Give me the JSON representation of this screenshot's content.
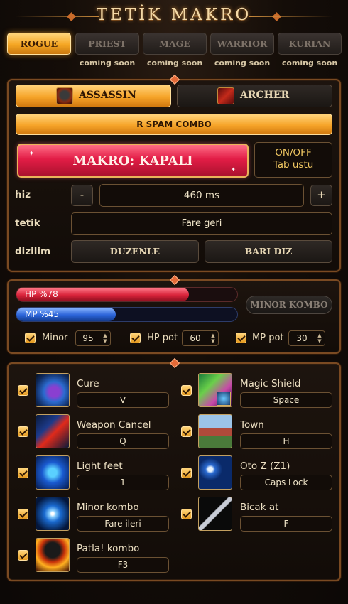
{
  "app": {
    "title": "TETİK MAKRO"
  },
  "tabs": [
    {
      "label": "ROGUE",
      "active": true,
      "note": ""
    },
    {
      "label": "PRIEST",
      "active": false,
      "note": "coming soon"
    },
    {
      "label": "MAGE",
      "active": false,
      "note": "coming soon"
    },
    {
      "label": "WARRIOR",
      "active": false,
      "note": "coming soon"
    },
    {
      "label": "KURIAN",
      "active": false,
      "note": "coming soon"
    }
  ],
  "classes": {
    "assassin": "ASSASSIN",
    "archer": "ARCHER",
    "selected": "assassin"
  },
  "combo_button": "R SPAM COMBO",
  "makro": {
    "toggle_label": "MAKRO: KAPALI",
    "onoff_line1": "ON/OFF",
    "onoff_line2": "Tab ustu"
  },
  "hiz": {
    "label": "hiz",
    "minus": "-",
    "value": "460 ms",
    "plus": "+"
  },
  "tetik": {
    "label": "tetik",
    "value": "Fare geri"
  },
  "dizilim": {
    "label": "dizilim",
    "edit": "DUZENLE",
    "bar": "BARI DIZ"
  },
  "bars": {
    "hp_label": "HP  %78",
    "hp_percent": 78,
    "mp_label": "MP  %45",
    "mp_percent": 45,
    "minor_combo": "MINOR KOMBO"
  },
  "settings": [
    {
      "label": "Minor",
      "value": "95",
      "checked": true
    },
    {
      "label": "HP pot",
      "value": "60",
      "checked": true
    },
    {
      "label": "MP pot",
      "value": "30",
      "checked": true
    }
  ],
  "skills": [
    {
      "name": "Cure",
      "key": "V",
      "checked": true,
      "icon": "cure-icon"
    },
    {
      "name": "Magic Shield",
      "key": "Space",
      "checked": true,
      "icon": "magic-shield-icon"
    },
    {
      "name": "Weapon Cancel",
      "key": "Q",
      "checked": true,
      "icon": "weapon-cancel-icon"
    },
    {
      "name": "Town",
      "key": "H",
      "checked": true,
      "icon": "town-icon"
    },
    {
      "name": "Light feet",
      "key": "1",
      "checked": true,
      "icon": "light-feet-icon"
    },
    {
      "name": "Oto Z (Z1)",
      "key": "Caps Lock",
      "checked": true,
      "icon": "oto-z-icon"
    },
    {
      "name": "Minor kombo",
      "key": "Fare ileri",
      "checked": true,
      "icon": "minor-kombo-icon"
    },
    {
      "name": "Bicak at",
      "key": "F",
      "checked": true,
      "icon": "bicak-at-icon"
    },
    {
      "name": "Patla! kombo",
      "key": "F3",
      "checked": true,
      "icon": "patla-kombo-icon"
    }
  ],
  "colors": {
    "accent": "#f6a429",
    "hp": "#d8233a",
    "mp": "#2a63d8",
    "danger": "#c8102e"
  }
}
